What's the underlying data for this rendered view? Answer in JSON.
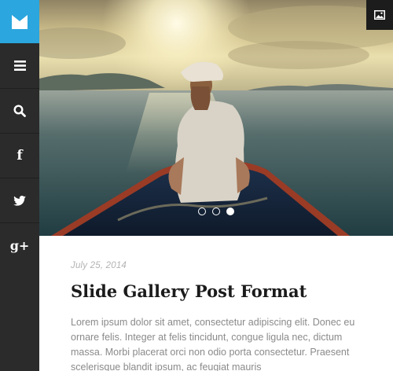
{
  "sidebar": {
    "logo_icon": "m-logo-icon",
    "items": [
      {
        "icon": "menu-icon"
      },
      {
        "icon": "search-icon"
      },
      {
        "icon": "facebook-icon",
        "glyph": "f"
      },
      {
        "icon": "twitter-icon"
      },
      {
        "icon": "google-plus-icon",
        "glyph": "g+"
      }
    ]
  },
  "hero": {
    "format_icon": "image-icon",
    "slides": 3,
    "active_slide": 3
  },
  "post": {
    "date": "July 25, 2014",
    "title": "Slide Gallery Post Format",
    "excerpt": "Lorem ipsum dolor sit amet, consectetur adipiscing elit. Donec eu ornare felis. Integer at felis tincidunt, congue ligula nec, dictum massa. Morbi placerat orci non odio porta consectetur. Praesent scelerisque blandit ipsum, ac feugiat mauris"
  },
  "colors": {
    "accent": "#2ba6de",
    "sidebar": "#2b2b2b",
    "title": "#1b1b1b",
    "meta": "#b3b3b3",
    "body_text": "#8a8a8a"
  }
}
